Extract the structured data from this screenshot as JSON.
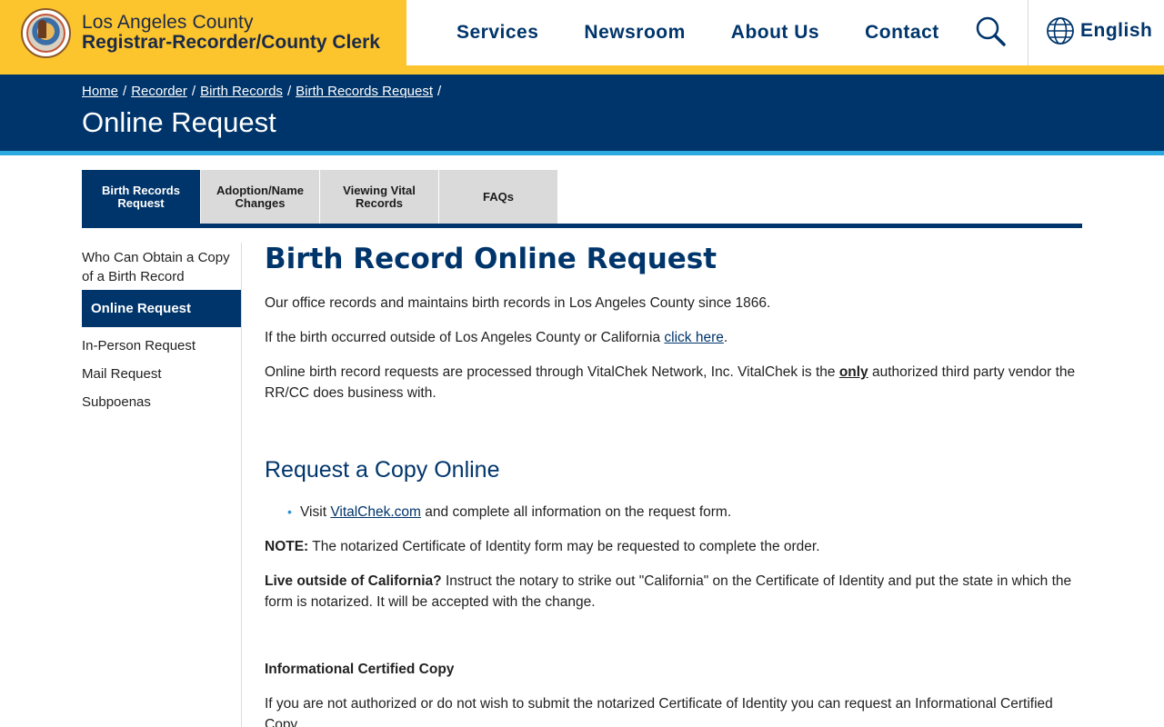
{
  "header": {
    "brand_line1": "Los Angeles County",
    "brand_line2": "Registrar-Recorder/County Clerk",
    "nav": [
      "Services",
      "Newsroom",
      "About Us",
      "Contact"
    ],
    "language": "English",
    "brand_color": "#fdc52d",
    "navy_color": "#00356b"
  },
  "breadcrumb": [
    "Home",
    "Recorder",
    "Birth Records",
    "Birth Records Request"
  ],
  "page_title": "Online Request",
  "tabs": [
    {
      "label": "Birth Records Request",
      "active": true
    },
    {
      "label": "Adoption/Name Changes",
      "active": false
    },
    {
      "label": "Viewing Vital Records",
      "active": false
    },
    {
      "label": "FAQs",
      "active": false
    }
  ],
  "sidebar": [
    {
      "label": "Who Can Obtain a Copy of a Birth Record",
      "active": false
    },
    {
      "label": "Online Request",
      "active": true
    },
    {
      "label": "In-Person Request",
      "active": false
    },
    {
      "label": "Mail Request",
      "active": false
    },
    {
      "label": "Subpoenas",
      "active": false
    }
  ],
  "content": {
    "heading": "Birth Record Online Request",
    "p1": "Our office records and maintains birth records in Los Angeles County since 1866.",
    "p2_before": "If the birth occurred outside of Los Angeles County or California ",
    "p2_link": "click here",
    "p2_after": ".",
    "p3_before": "Online birth record requests are processed through VitalChek Network, Inc. VitalChek is the ",
    "p3_only": "only",
    "p3_after": " authorized third party vendor the RR/CC does business with.",
    "section_heading": "Request a Copy Online",
    "bullet_before": "Visit ",
    "bullet_link": "VitalChek.com",
    "bullet_after": " and complete all information on the request form.",
    "note_label": "NOTE:",
    "note_text": " The notarized Certificate of Identity form may be requested to complete the order.",
    "live_label": "Live outside of California?",
    "live_text": " Instruct the notary to strike out \"California\" on the Certificate of Identity and put the state in which the form is notarized. It will be accepted with the change.",
    "informational_heading": "Informational Certified Copy",
    "informational_text": "If you are not authorized or do not wish to submit the notarized Certificate of Identity you can request an Informational Certified Copy."
  }
}
